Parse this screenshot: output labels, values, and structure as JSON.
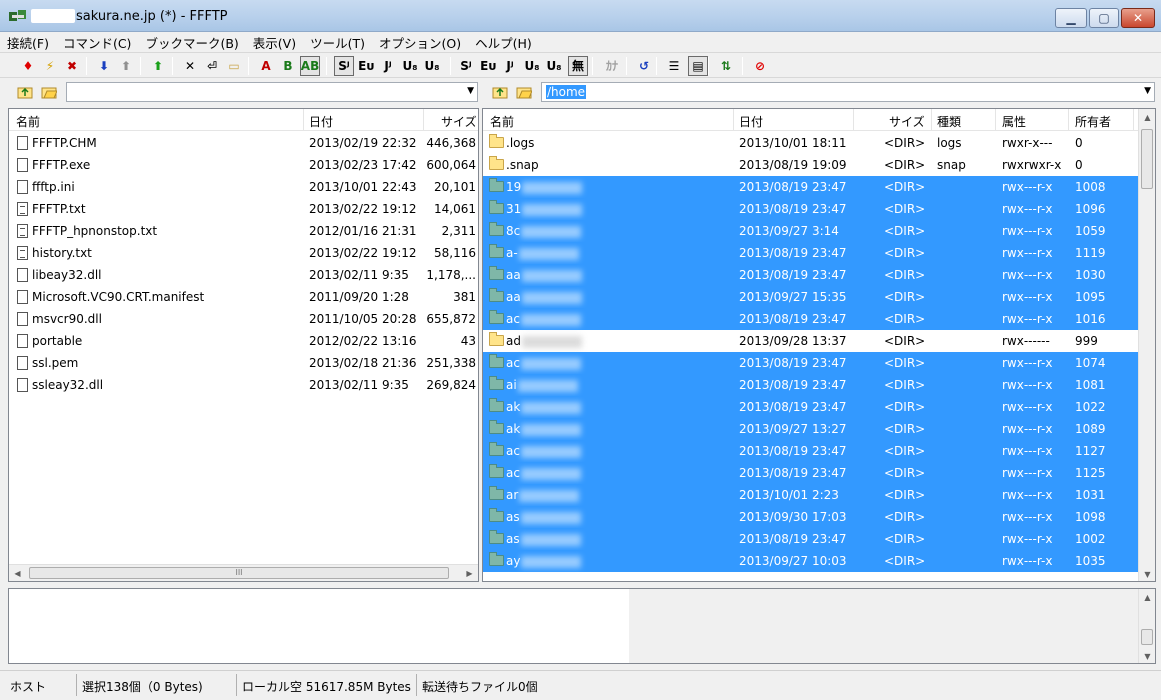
{
  "window": {
    "title": "sakura.ne.jp (*) - FFFTP"
  },
  "menu": [
    "接続(F)",
    "コマンド(C)",
    "ブックマーク(B)",
    "表示(V)",
    "ツール(T)",
    "オプション(O)",
    "ヘルプ(H)"
  ],
  "toolbar": {
    "buttons": [
      {
        "name": "connect-icon",
        "glyph": "♦",
        "color": "#e00000"
      },
      {
        "name": "quick-connect-icon",
        "glyph": "⚡",
        "color": "#d4a000"
      },
      {
        "name": "disconnect-icon",
        "glyph": "✖",
        "color": "#c00000"
      },
      {
        "name": "download-icon",
        "glyph": "⬇",
        "color": "#1a3fbf"
      },
      {
        "name": "upload-icon",
        "glyph": "⬆",
        "color": "#909090"
      },
      {
        "name": "mirror-upload-icon",
        "glyph": "⬆",
        "color": "#1aa01a"
      },
      {
        "name": "delete-icon",
        "glyph": "✕",
        "color": "#000"
      },
      {
        "name": "rename-icon",
        "glyph": "⏎",
        "color": "#000"
      },
      {
        "name": "mkdir-icon",
        "glyph": "▭",
        "color": "#c9a54a"
      },
      {
        "name": "ascii-mode-icon",
        "glyph": "A",
        "color": "#c00000"
      },
      {
        "name": "binary-mode-icon",
        "glyph": "B",
        "color": "#1a7a1a"
      },
      {
        "name": "auto-mode-icon",
        "glyph": "AB",
        "color": "#1a7a1a"
      },
      {
        "name": "host-sjis-icon",
        "glyph": "Sᴶ",
        "color": "#000"
      },
      {
        "name": "host-euc-icon",
        "glyph": "Eᴜ",
        "color": "#000"
      },
      {
        "name": "host-jis-icon",
        "glyph": "Jᴶ",
        "color": "#000"
      },
      {
        "name": "host-utf8n-icon",
        "glyph": "U₈",
        "color": "#000"
      },
      {
        "name": "host-utf8-icon",
        "glyph": "U₈",
        "color": "#000"
      },
      {
        "name": "local-sjis-icon",
        "glyph": "Sᴶ",
        "color": "#000"
      },
      {
        "name": "local-euc-icon",
        "glyph": "Eᴜ",
        "color": "#000"
      },
      {
        "name": "local-jis-icon",
        "glyph": "Jᴶ",
        "color": "#000"
      },
      {
        "name": "local-utf8n-icon",
        "glyph": "U₈",
        "color": "#000"
      },
      {
        "name": "local-utf8-icon",
        "glyph": "U₈",
        "color": "#000"
      },
      {
        "name": "no-conversion-icon",
        "glyph": "無",
        "color": "#000"
      },
      {
        "name": "kana-icon",
        "glyph": "ｶﾅ",
        "color": "#a0a0a0"
      },
      {
        "name": "refresh-icon",
        "glyph": "↺",
        "color": "#1a3fbf"
      },
      {
        "name": "list-view-icon",
        "glyph": "☰",
        "color": "#000"
      },
      {
        "name": "detail-view-icon",
        "glyph": "▤",
        "color": "#000"
      },
      {
        "name": "sync-folder-icon",
        "glyph": "⇅",
        "color": "#1a7a1a"
      },
      {
        "name": "stop-icon",
        "glyph": "⊘",
        "color": "#e00000"
      }
    ]
  },
  "local": {
    "path": "",
    "columns": [
      "名前",
      "日付",
      "サイズ"
    ],
    "files": [
      {
        "name": "FFFTP.CHM",
        "date": "2013/02/19 22:32",
        "size": "446,368",
        "icon": "file"
      },
      {
        "name": "FFFTP.exe",
        "date": "2013/02/23 17:42",
        "size": "600,064",
        "icon": "file"
      },
      {
        "name": "ffftp.ini",
        "date": "2013/10/01 22:43",
        "size": "20,101",
        "icon": "file"
      },
      {
        "name": "FFFTP.txt",
        "date": "2013/02/22 19:12",
        "size": "14,061",
        "icon": "txt"
      },
      {
        "name": "FFFTP_hpnonstop.txt",
        "date": "2012/01/16 21:31",
        "size": "2,311",
        "icon": "txt"
      },
      {
        "name": "history.txt",
        "date": "2013/02/22 19:12",
        "size": "58,116",
        "icon": "txt"
      },
      {
        "name": "libeay32.dll",
        "date": "2013/02/11  9:35",
        "size": "1,178,...",
        "icon": "file"
      },
      {
        "name": "Microsoft.VC90.CRT.manifest",
        "date": "2011/09/20  1:28",
        "size": "381",
        "icon": "file"
      },
      {
        "name": "msvcr90.dll",
        "date": "2011/10/05 20:28",
        "size": "655,872",
        "icon": "file"
      },
      {
        "name": "portable",
        "date": "2012/02/22 13:16",
        "size": "43",
        "icon": "file"
      },
      {
        "name": "ssl.pem",
        "date": "2013/02/18 21:36",
        "size": "251,338",
        "icon": "file"
      },
      {
        "name": "ssleay32.dll",
        "date": "2013/02/11  9:35",
        "size": "269,824",
        "icon": "file"
      }
    ],
    "hscroll_thumb": "III"
  },
  "remote": {
    "path": "/home",
    "columns": [
      "名前",
      "日付",
      "サイズ",
      "種類",
      "属性",
      "所有者"
    ],
    "files": [
      {
        "name": ".logs",
        "date": "2013/10/01 18:11",
        "size": "<DIR>",
        "type": "logs",
        "attr": "rwxr-x---",
        "owner": "0",
        "selected": false,
        "blurred": false
      },
      {
        "name": ".snap",
        "date": "2013/08/19 19:09",
        "size": "<DIR>",
        "type": "snap",
        "attr": "rwxrwxr-x",
        "owner": "0",
        "selected": false,
        "blurred": false
      },
      {
        "name": "19",
        "date": "2013/08/19 23:47",
        "size": "<DIR>",
        "type": "",
        "attr": "rwx---r-x",
        "owner": "1008",
        "selected": true,
        "blurred": true
      },
      {
        "name": "31",
        "date": "2013/08/19 23:47",
        "size": "<DIR>",
        "type": "",
        "attr": "rwx---r-x",
        "owner": "1096",
        "selected": true,
        "blurred": true
      },
      {
        "name": "8c",
        "date": "2013/09/27  3:14",
        "size": "<DIR>",
        "type": "",
        "attr": "rwx---r-x",
        "owner": "1059",
        "selected": true,
        "blurred": true
      },
      {
        "name": "a-",
        "date": "2013/08/19 23:47",
        "size": "<DIR>",
        "type": "",
        "attr": "rwx---r-x",
        "owner": "1119",
        "selected": true,
        "blurred": true
      },
      {
        "name": "aa",
        "date": "2013/08/19 23:47",
        "size": "<DIR>",
        "type": "",
        "attr": "rwx---r-x",
        "owner": "1030",
        "selected": true,
        "blurred": true
      },
      {
        "name": "aa",
        "date": "2013/09/27 15:35",
        "size": "<DIR>",
        "type": "",
        "attr": "rwx---r-x",
        "owner": "1095",
        "selected": true,
        "blurred": true
      },
      {
        "name": "ac",
        "date": "2013/08/19 23:47",
        "size": "<DIR>",
        "type": "",
        "attr": "rwx---r-x",
        "owner": "1016",
        "selected": true,
        "blurred": true
      },
      {
        "name": "ad",
        "date": "2013/09/28 13:37",
        "size": "<DIR>",
        "type": "",
        "attr": "rwx------",
        "owner": "999",
        "selected": false,
        "blurred": true
      },
      {
        "name": "ac",
        "date": "2013/08/19 23:47",
        "size": "<DIR>",
        "type": "",
        "attr": "rwx---r-x",
        "owner": "1074",
        "selected": true,
        "blurred": true
      },
      {
        "name": "ai",
        "date": "2013/08/19 23:47",
        "size": "<DIR>",
        "type": "",
        "attr": "rwx---r-x",
        "owner": "1081",
        "selected": true,
        "blurred": true
      },
      {
        "name": "ak",
        "date": "2013/08/19 23:47",
        "size": "<DIR>",
        "type": "",
        "attr": "rwx---r-x",
        "owner": "1022",
        "selected": true,
        "blurred": true
      },
      {
        "name": "ak",
        "date": "2013/09/27 13:27",
        "size": "<DIR>",
        "type": "",
        "attr": "rwx---r-x",
        "owner": "1089",
        "selected": true,
        "blurred": true
      },
      {
        "name": "ac",
        "date": "2013/08/19 23:47",
        "size": "<DIR>",
        "type": "",
        "attr": "rwx---r-x",
        "owner": "1127",
        "selected": true,
        "blurred": true
      },
      {
        "name": "ac",
        "date": "2013/08/19 23:47",
        "size": "<DIR>",
        "type": "",
        "attr": "rwx---r-x",
        "owner": "1125",
        "selected": true,
        "blurred": true
      },
      {
        "name": "ar",
        "date": "2013/10/01  2:23",
        "size": "<DIR>",
        "type": "",
        "attr": "rwx---r-x",
        "owner": "1031",
        "selected": true,
        "blurred": true
      },
      {
        "name": "as",
        "date": "2013/09/30 17:03",
        "size": "<DIR>",
        "type": "",
        "attr": "rwx---r-x",
        "owner": "1098",
        "selected": true,
        "blurred": true
      },
      {
        "name": "as",
        "date": "2013/08/19 23:47",
        "size": "<DIR>",
        "type": "",
        "attr": "rwx---r-x",
        "owner": "1002",
        "selected": true,
        "blurred": true
      },
      {
        "name": "ay",
        "date": "2013/09/27 10:03",
        "size": "<DIR>",
        "type": "",
        "attr": "rwx---r-x",
        "owner": "1035",
        "selected": true,
        "blurred": true
      }
    ]
  },
  "status": {
    "host": "ホスト",
    "selection": "選択138個（0 Bytes)",
    "local_free": "ローカル空 51617.85M Bytes",
    "queue": "転送待ちファイル0個"
  },
  "colors": {
    "selection": "#3399ff",
    "titlebar": "#b9d1ec"
  }
}
